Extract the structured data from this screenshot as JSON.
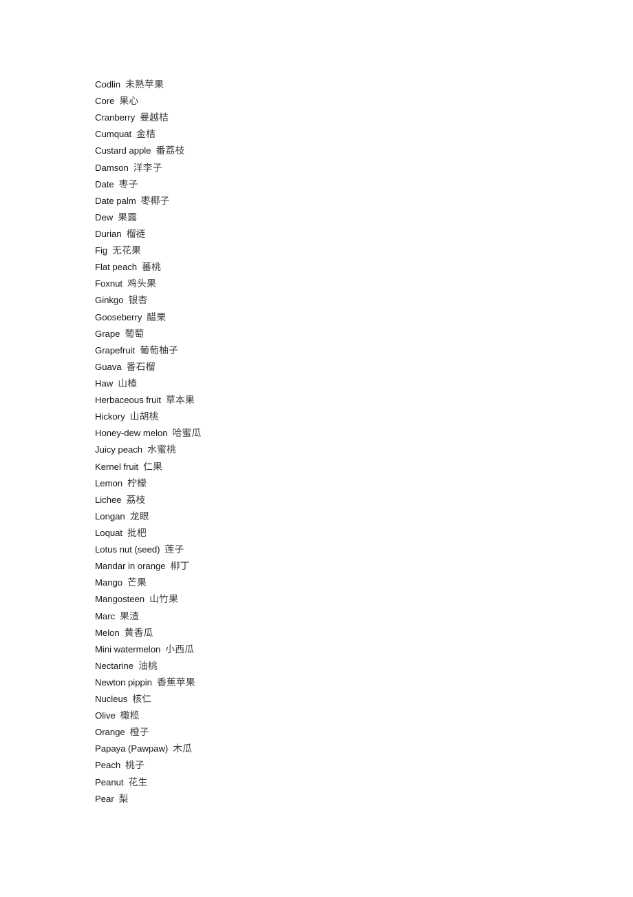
{
  "page": {
    "background_color": "#ffffff",
    "text_color": "#141414",
    "gloss_color": "#3a3a3a"
  },
  "glossary": {
    "entries": [
      {
        "en": "Codlin",
        "zh": "未熟苹果"
      },
      {
        "en": "Core",
        "zh": "果心"
      },
      {
        "en": "Cranberry",
        "zh": "曼越桔"
      },
      {
        "en": "Cumquat",
        "zh": "金桔"
      },
      {
        "en": "Custard apple",
        "zh": "番荔枝"
      },
      {
        "en": "Damson",
        "zh": "洋李子"
      },
      {
        "en": "Date",
        "zh": "枣子"
      },
      {
        "en": "Date palm",
        "zh": "枣椰子"
      },
      {
        "en": "Dew",
        "zh": "果露"
      },
      {
        "en": "Durian",
        "zh": "榴裢"
      },
      {
        "en": "Fig",
        "zh": "无花果"
      },
      {
        "en": "Flat peach",
        "zh": "蕃桃"
      },
      {
        "en": "Foxnut",
        "zh": "鸡头果"
      },
      {
        "en": "Ginkgo",
        "zh": "银杏"
      },
      {
        "en": "Gooseberry",
        "zh": "醋栗"
      },
      {
        "en": "Grape",
        "zh": "葡萄"
      },
      {
        "en": "Grapefruit",
        "zh": "葡萄柚子"
      },
      {
        "en": "Guava",
        "zh": "番石榴"
      },
      {
        "en": "Haw",
        "zh": "山楂"
      },
      {
        "en": "Herbaceous fruit",
        "zh": "草本果"
      },
      {
        "en": "Hickory",
        "zh": "山胡桃"
      },
      {
        "en": "Honey-dew melon",
        "zh": "哈蜜瓜"
      },
      {
        "en": "Juicy peach",
        "zh": "水蜜桃"
      },
      {
        "en": "Kernel fruit",
        "zh": "仁果"
      },
      {
        "en": "Lemon",
        "zh": "柠檬"
      },
      {
        "en": "Lichee",
        "zh": "荔枝"
      },
      {
        "en": "Longan",
        "zh": "龙眼"
      },
      {
        "en": "Loquat",
        "zh": "批杷"
      },
      {
        "en": "Lotus nut (seed)",
        "zh": "莲子"
      },
      {
        "en": "Mandar in orange",
        "zh": "柳丁"
      },
      {
        "en": "Mango",
        "zh": "芒果"
      },
      {
        "en": "Mangosteen",
        "zh": "山竹果"
      },
      {
        "en": "Marc",
        "zh": "果渣"
      },
      {
        "en": "Melon",
        "zh": "黄香瓜"
      },
      {
        "en": "Mini watermelon",
        "zh": "小西瓜"
      },
      {
        "en": "Nectarine",
        "zh": "油桃"
      },
      {
        "en": "Newton pippin",
        "zh": "香蕉苹果"
      },
      {
        "en": "Nucleus",
        "zh": "核仁"
      },
      {
        "en": "Olive",
        "zh": "橄榄"
      },
      {
        "en": "Orange",
        "zh": "橙子"
      },
      {
        "en": "Papaya (Pawpaw)",
        "zh": "木瓜"
      },
      {
        "en": "Peach",
        "zh": "桃子"
      },
      {
        "en": "Peanut",
        "zh": "花生"
      },
      {
        "en": "Pear",
        "zh": "梨"
      }
    ]
  }
}
